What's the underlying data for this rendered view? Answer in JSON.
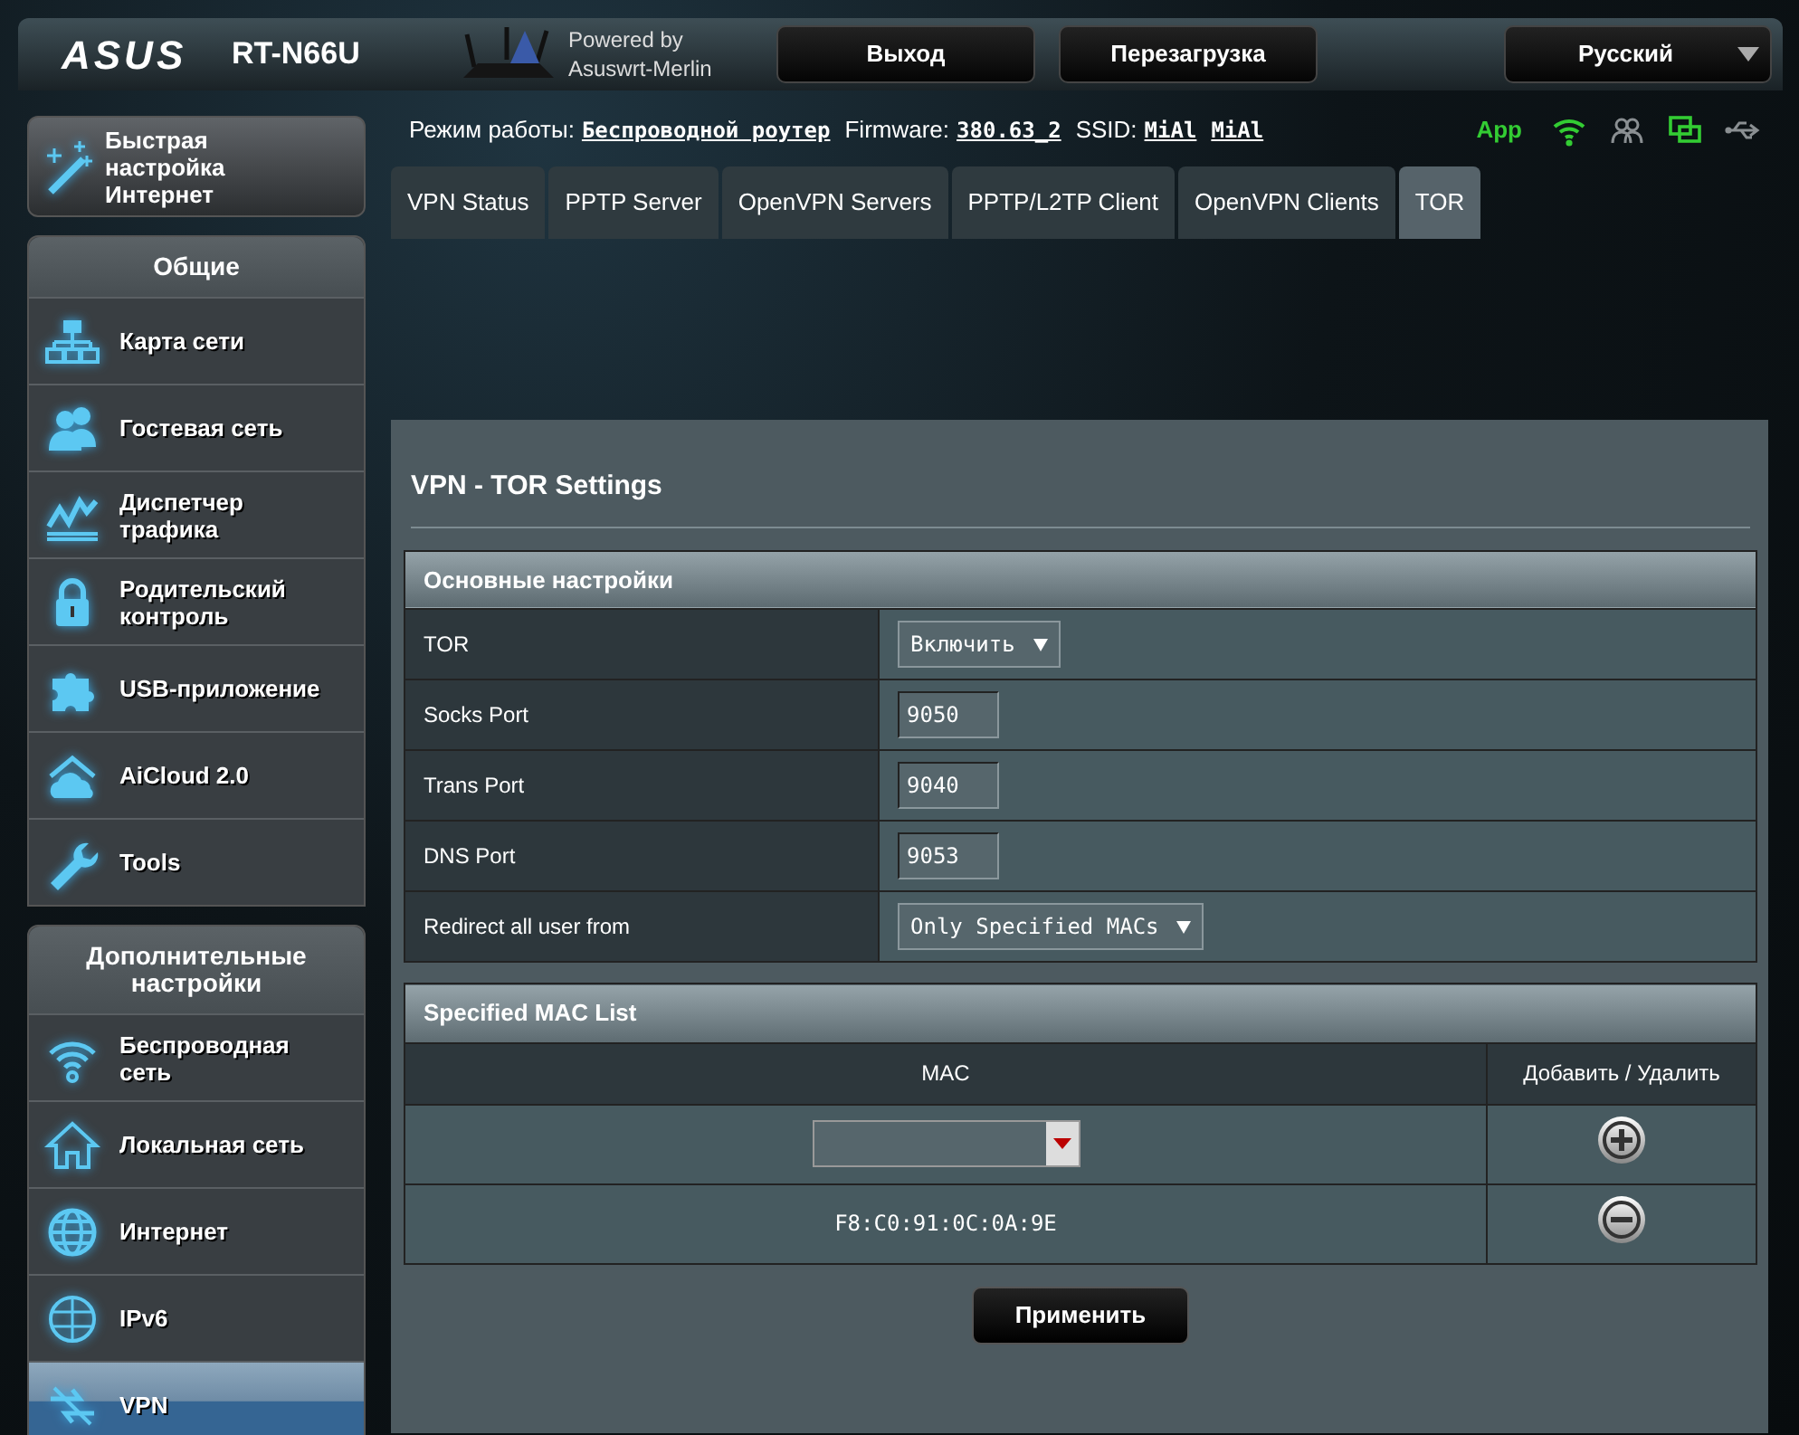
{
  "header": {
    "logo": "ASUS",
    "model": "RT-N66U",
    "powered_by": "Powered by",
    "firmware_name": "Asuswrt-Merlin",
    "buttons": [
      "Выход",
      "Перезагрузка"
    ],
    "language": "Русский"
  },
  "status": {
    "mode_label": "Режим работы:",
    "mode": "Беспроводной роутер",
    "firmware_label": "Firmware:",
    "firmware": "380.63_2",
    "ssid_label": "SSID:",
    "ssids": [
      "MiAl",
      "MiAl"
    ],
    "app": "App",
    "icons": [
      {
        "kind": "wifi",
        "on": true
      },
      {
        "kind": "people",
        "on": false
      },
      {
        "kind": "monitor",
        "on": true
      },
      {
        "kind": "usb",
        "on": false
      }
    ]
  },
  "sidebar": {
    "quick_setup": "Быстрая настройка Интернет",
    "groups": [
      {
        "title": "Общие",
        "items": [
          {
            "label": "Карта сети",
            "kind": "network",
            "selected": false
          },
          {
            "label": "Гостевая сеть",
            "kind": "guests",
            "selected": false
          },
          {
            "label": "Диспетчер трафика",
            "kind": "traffic",
            "selected": false
          },
          {
            "label": "Родительский контроль",
            "kind": "lock",
            "selected": false
          },
          {
            "label": "USB-приложение",
            "kind": "puzzle",
            "selected": false
          },
          {
            "label": "AiCloud 2.0",
            "kind": "cloud",
            "selected": false
          },
          {
            "label": "Tools",
            "kind": "wrench",
            "selected": false
          }
        ]
      },
      {
        "title": "Дополнительные настройки",
        "items": [
          {
            "label": "Беспроводная сеть",
            "kind": "wifi",
            "selected": false
          },
          {
            "label": "Локальная сеть",
            "kind": "house",
            "selected": false
          },
          {
            "label": "Интернет",
            "kind": "globe",
            "selected": false
          },
          {
            "label": "IPv6",
            "kind": "globe2",
            "selected": false
          },
          {
            "label": "VPN",
            "kind": "vpn",
            "selected": true
          }
        ]
      }
    ]
  },
  "tabs": [
    {
      "label": "VPN Status",
      "selected": false
    },
    {
      "label": "PPTP Server",
      "selected": false
    },
    {
      "label": "OpenVPN Servers",
      "selected": false
    },
    {
      "label": "PPTP/L2TP Client",
      "selected": false
    },
    {
      "label": "OpenVPN Clients",
      "selected": false
    },
    {
      "label": "TOR",
      "selected": true
    }
  ],
  "panel": {
    "title": "VPN - TOR Settings",
    "basic": {
      "title": "Основные настройки",
      "rows": [
        {
          "label": "TOR",
          "kind": "select",
          "value": "Включить"
        },
        {
          "label": "Socks Port",
          "kind": "input",
          "value": "9050"
        },
        {
          "label": "Trans Port",
          "kind": "input",
          "value": "9040"
        },
        {
          "label": "DNS Port",
          "kind": "input",
          "value": "9053"
        },
        {
          "label": "Redirect all user from",
          "kind": "select",
          "value": "Only Specified MACs"
        }
      ]
    },
    "mac_list": {
      "title": "Specified MAC List",
      "columns": [
        "MAC",
        "Добавить / Удалить"
      ],
      "entries": [
        "F8:C0:91:0C:0A:9E"
      ]
    },
    "apply": "Применить"
  }
}
